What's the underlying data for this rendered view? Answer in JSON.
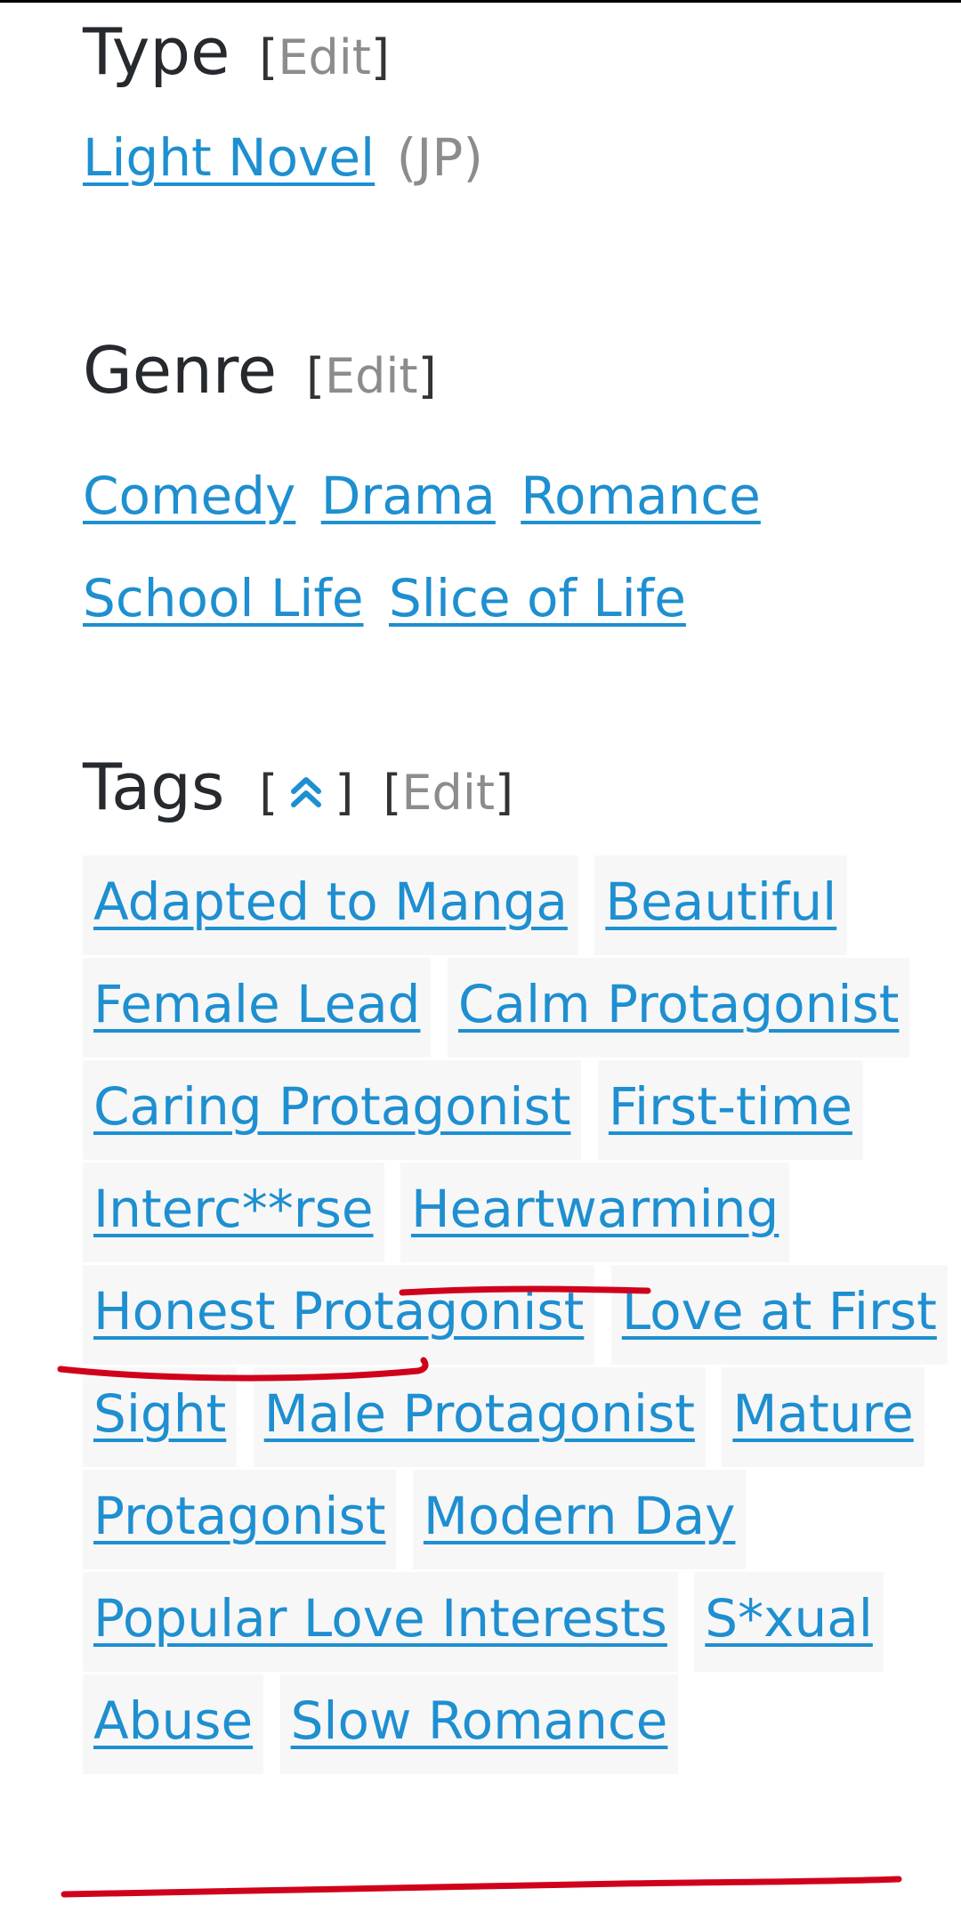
{
  "type_section": {
    "heading": "Type",
    "edit_label": "Edit",
    "value_link": "Light Novel",
    "value_region": "(JP)"
  },
  "genre_section": {
    "heading": "Genre",
    "edit_label": "Edit",
    "items": [
      "Comedy",
      "Drama",
      "Romance",
      "School Life",
      "Slice of Life"
    ]
  },
  "tags_section": {
    "heading": "Tags",
    "toggle_icon": "double-chevron-up-icon",
    "edit_label": "Edit",
    "items": [
      "Adapted to Manga",
      "Beautiful Female Lead",
      "Calm Protagonist",
      "Caring Protagonist",
      "First-time Interc**rse",
      "Heartwarming",
      "Honest Protagonist",
      "Love at First Sight",
      "Male Protagonist",
      "Mature Protagonist",
      "Modern Day",
      "Popular Love Interests",
      "S*xual Abuse",
      "Slow Romance"
    ]
  },
  "colors": {
    "link": "#1e8fd0",
    "heading": "#26292d",
    "muted": "#8c8c8c",
    "tag_background": "#f7f7f8",
    "annotation_marker": "#d0021b"
  }
}
